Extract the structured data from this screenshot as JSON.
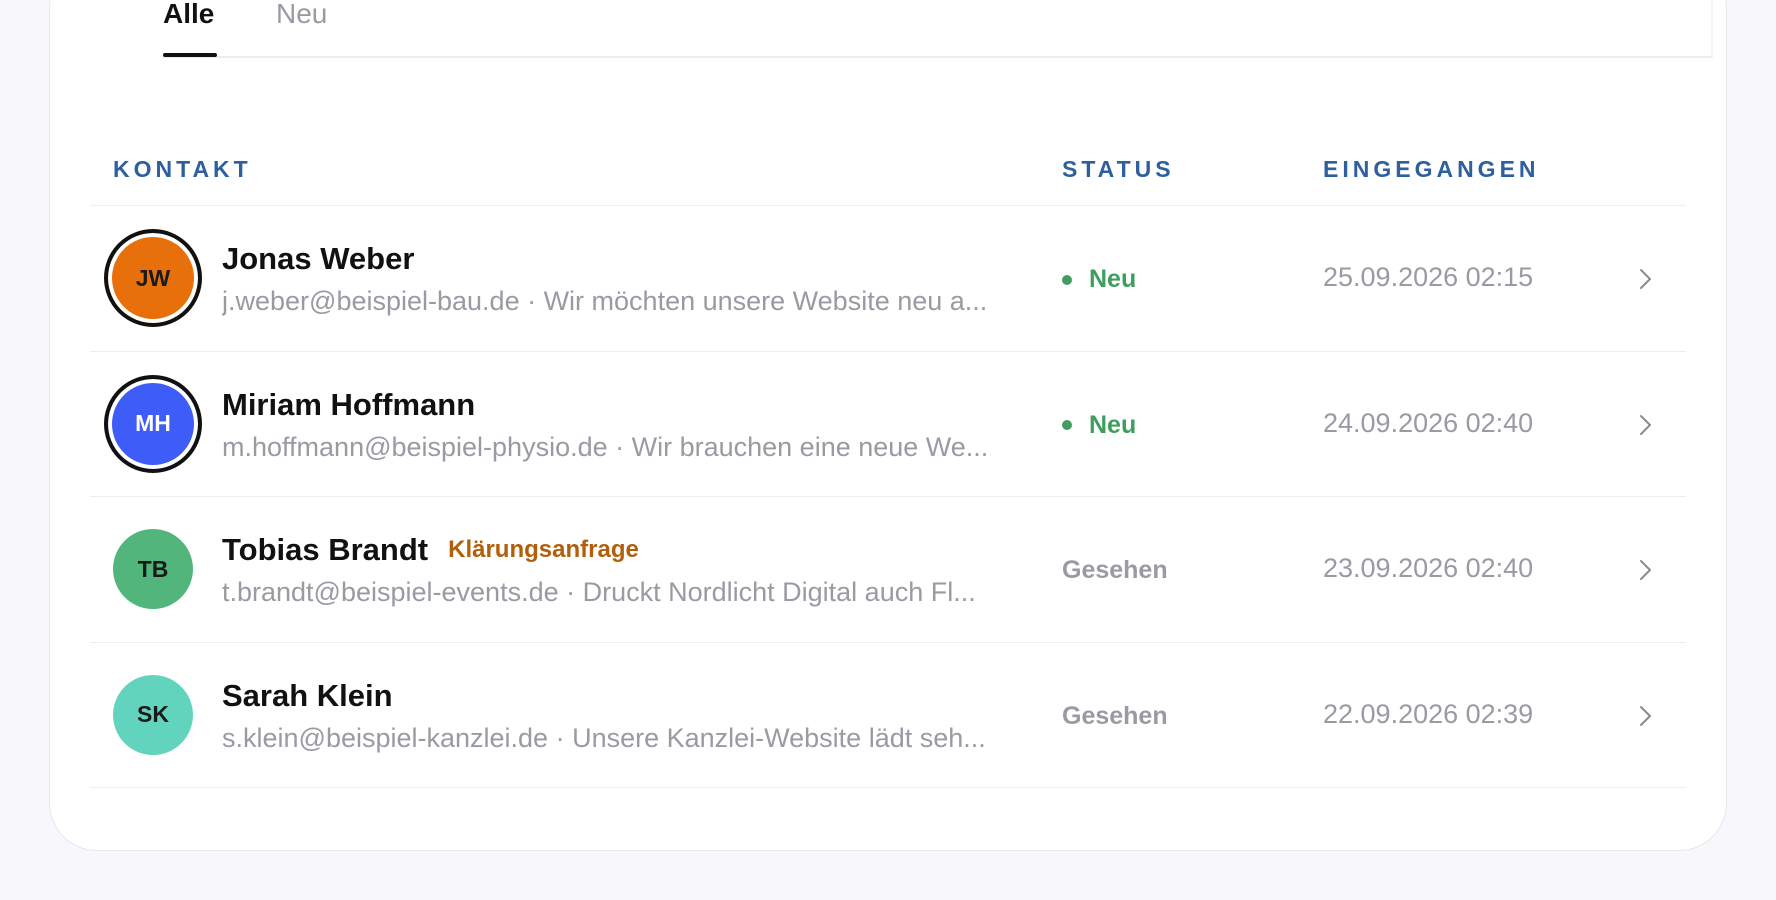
{
  "tabs": [
    {
      "label": "Alle",
      "active": true
    },
    {
      "label": "Neu",
      "active": false
    }
  ],
  "table": {
    "headers": {
      "contact": "KONTAKT",
      "status": "STATUS",
      "received": "EINGEGANGEN"
    },
    "rows": [
      {
        "initials": "JW",
        "avatar_color": "#e8700a",
        "initials_color": "#1a1a1a",
        "ring": true,
        "name": "Jonas Weber",
        "tag": "",
        "subline": "j.weber@beispiel-bau.de · Wir möchten unsere Website neu a...",
        "status": "Neu",
        "status_color": "#3f9e5e",
        "status_dot": true,
        "date": "25.09.2026 02:15"
      },
      {
        "initials": "MH",
        "avatar_color": "#3e5cf7",
        "initials_color": "#ffffff",
        "ring": true,
        "name": "Miriam Hoffmann",
        "tag": "",
        "subline": "m.hoffmann@beispiel-physio.de · Wir brauchen eine neue We...",
        "status": "Neu",
        "status_color": "#3f9e5e",
        "status_dot": true,
        "date": "24.09.2026 02:40"
      },
      {
        "initials": "TB",
        "avatar_color": "#52b67c",
        "initials_color": "#1a1a1a",
        "ring": false,
        "name": "Tobias Brandt",
        "tag": "Klärungsanfrage",
        "subline": "t.brandt@beispiel-events.de · Druckt Nordlicht Digital auch Fl...",
        "status": "Gesehen",
        "status_color": "#9a9aa2",
        "status_dot": false,
        "date": "23.09.2026 02:40"
      },
      {
        "initials": "SK",
        "avatar_color": "#62d3bd",
        "initials_color": "#1a1a1a",
        "ring": false,
        "name": "Sarah Klein",
        "tag": "",
        "subline": "s.klein@beispiel-kanzlei.de · Unsere Kanzlei-Website lädt seh...",
        "status": "Gesehen",
        "status_color": "#9a9aa2",
        "status_dot": false,
        "date": "22.09.2026 02:39"
      }
    ]
  },
  "colors": {
    "accent_header": "#2e5f9e",
    "status_new": "#3f9e5e",
    "tag": "#b25e0a"
  },
  "icons": {
    "row_action": "chevron-right-icon"
  }
}
